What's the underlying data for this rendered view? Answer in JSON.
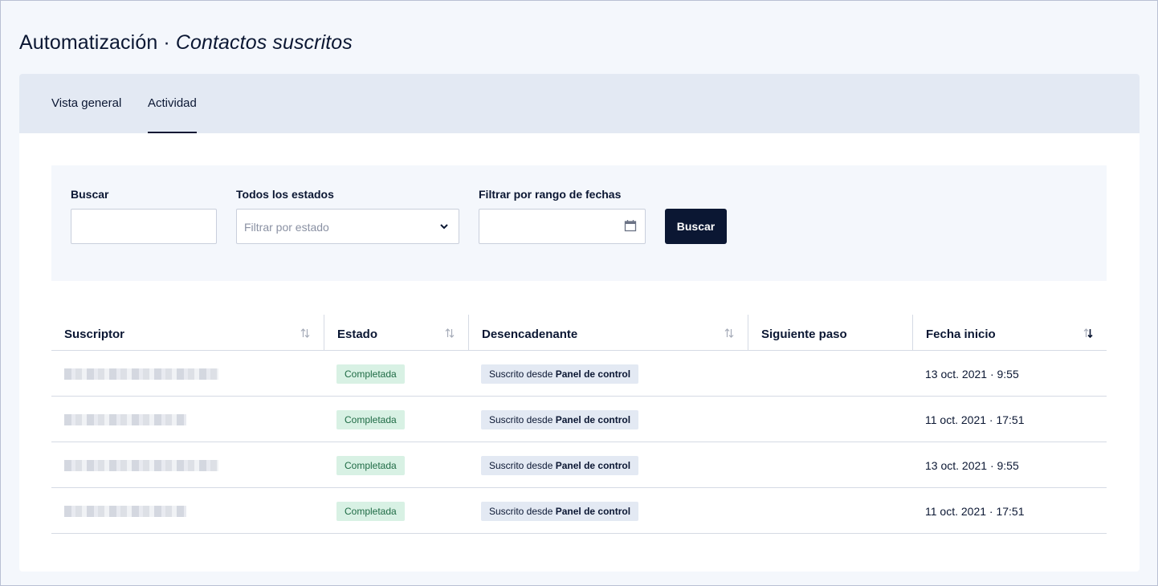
{
  "header": {
    "title_main": "Automatización · ",
    "title_sub": "Contactos suscritos"
  },
  "tabs": [
    {
      "label": "Vista general",
      "active": false
    },
    {
      "label": "Actividad",
      "active": true
    }
  ],
  "filters": {
    "search_label": "Buscar",
    "search_value": "",
    "status_label": "Todos los estados",
    "status_placeholder": "Filtrar por estado",
    "date_label": "Filtrar por rango de fechas",
    "date_value": "",
    "submit_label": "Buscar"
  },
  "table": {
    "columns": [
      {
        "label": "Suscriptor",
        "sortable": true,
        "sort": "none"
      },
      {
        "label": "Estado",
        "sortable": true,
        "sort": "none"
      },
      {
        "label": "Desencadenante",
        "sortable": true,
        "sort": "none"
      },
      {
        "label": "Siguiente paso",
        "sortable": false,
        "sort": "none"
      },
      {
        "label": "Fecha inicio",
        "sortable": true,
        "sort": "desc"
      }
    ],
    "rows": [
      {
        "subscriber": "",
        "status": "Completada",
        "trigger_prefix": "Suscrito desde",
        "trigger_source": "Panel de control",
        "next_step": "",
        "start_date": "13 oct. 2021 · 9:55"
      },
      {
        "subscriber": "",
        "status": "Completada",
        "trigger_prefix": "Suscrito desde",
        "trigger_source": "Panel de control",
        "next_step": "",
        "start_date": "11 oct. 2021 · 17:51"
      },
      {
        "subscriber": "",
        "status": "Completada",
        "trigger_prefix": "Suscrito desde",
        "trigger_source": "Panel de control",
        "next_step": "",
        "start_date": "13 oct. 2021 · 9:55"
      },
      {
        "subscriber": "",
        "status": "Completada",
        "trigger_prefix": "Suscrito desde",
        "trigger_source": "Panel de control",
        "next_step": "",
        "start_date": "11 oct. 2021 · 17:51"
      }
    ]
  },
  "colors": {
    "primary": "#0b1733",
    "background": "#f4f7fc",
    "tabs_bg": "#e3e9f3",
    "status_ok_bg": "#d8f1e4",
    "status_ok_text": "#1f6b45"
  }
}
